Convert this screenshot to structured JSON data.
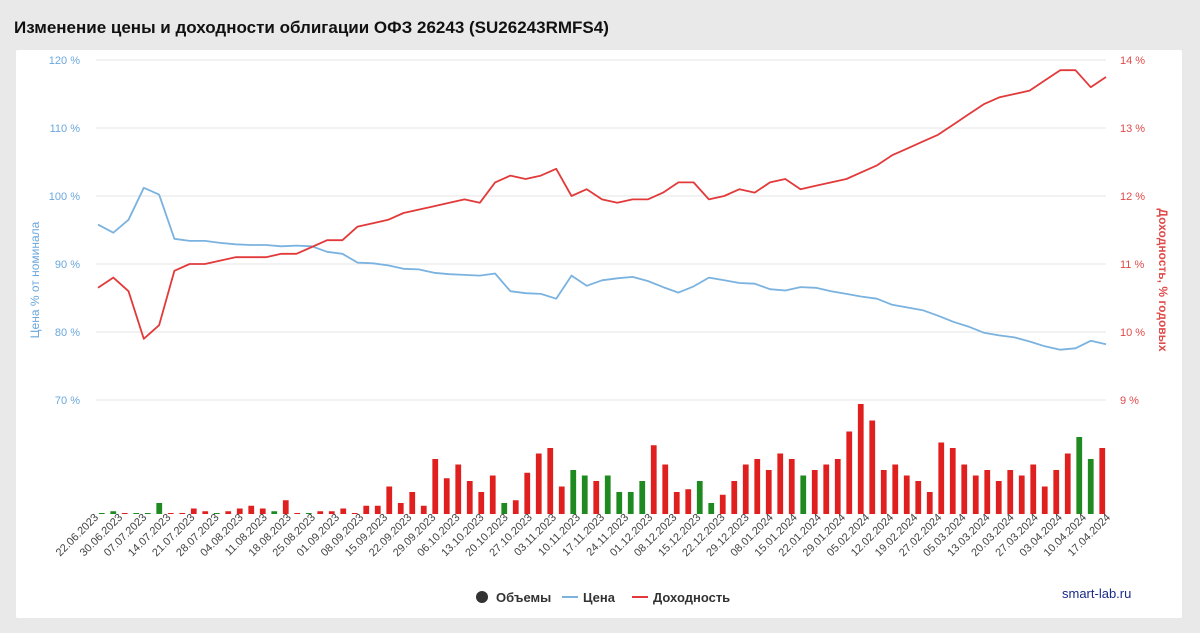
{
  "page": {
    "title": "Изменение цены и доходности облигации ОФЗ 26243 (SU26243RMFS4)",
    "credit": "smart-lab.ru"
  },
  "colors": {
    "price": "#7ab2e0",
    "yield": "#e23a3a",
    "volume_up": "#1f8a1f",
    "volume_down": "#e01f1f",
    "grid": "#e6e6e6"
  },
  "chart_data": {
    "type": "line",
    "title": "Изменение цены и доходности облигации ОФЗ 26243 (SU26243RMFS4)",
    "y_left": {
      "label": "Цена % от номинала",
      "range": [
        70,
        120
      ],
      "ticks": [
        70,
        80,
        90,
        100,
        110,
        120
      ],
      "tick_labels": [
        "70 %",
        "80 %",
        "90 %",
        "100 %",
        "110 %",
        "120 %"
      ]
    },
    "y_right": {
      "label": "Доходность, % годовых",
      "range": [
        9,
        14
      ],
      "ticks": [
        9,
        10,
        11,
        12,
        13,
        14
      ],
      "tick_labels": [
        "9 %",
        "10 %",
        "11 %",
        "12 %",
        "13 %",
        "14 %"
      ]
    },
    "x": {
      "labels": [
        "22.06.2023",
        "30.06.2023",
        "07.07.2023",
        "14.07.2023",
        "21.07.2023",
        "28.07.2023",
        "04.08.2023",
        "11.08.2023",
        "18.08.2023",
        "25.08.2023",
        "01.09.2023",
        "08.09.2023",
        "15.09.2023",
        "22.09.2023",
        "29.09.2023",
        "06.10.2023",
        "13.10.2023",
        "20.10.2023",
        "27.10.2023",
        "03.11.2023",
        "10.11.2023",
        "17.11.2023",
        "24.11.2023",
        "01.12.2023",
        "08.12.2023",
        "15.12.2023",
        "22.12.2023",
        "29.12.2023",
        "08.01.2024",
        "15.01.2024",
        "22.01.2024",
        "29.01.2024",
        "05.02.2024",
        "12.02.2024",
        "19.02.2024",
        "27.02.2024",
        "05.03.2024",
        "13.03.2024",
        "20.03.2024",
        "27.03.2024",
        "03.04.2024",
        "10.04.2024",
        "17.04.2024"
      ]
    },
    "series": [
      {
        "name": "Цена",
        "axis": "left",
        "values": [
          95.8,
          94.6,
          96.5,
          101.2,
          100.2,
          93.7,
          93.4,
          93.4,
          93.1,
          92.9,
          92.8,
          92.8,
          92.6,
          92.7,
          92.6,
          91.8,
          91.5,
          90.2,
          90.1,
          89.8,
          89.3,
          89.2,
          88.7,
          88.5,
          88.4,
          88.3,
          88.6,
          86.0,
          85.7,
          85.6,
          84.9,
          88.3,
          86.8,
          87.6,
          87.9,
          88.1,
          87.5,
          86.6,
          85.8,
          86.7,
          88.0,
          87.6,
          87.2,
          87.1,
          86.3,
          86.1,
          86.6,
          86.5,
          86.0,
          85.6,
          85.2,
          84.9,
          84.0,
          83.6,
          83.2,
          82.4,
          81.5,
          80.8,
          79.9,
          79.5,
          79.2,
          78.6,
          77.9,
          77.4,
          77.6,
          78.7,
          78.2
        ]
      },
      {
        "name": "Доходность",
        "axis": "right",
        "values": [
          10.65,
          10.8,
          10.6,
          9.9,
          10.1,
          10.9,
          11.0,
          11.0,
          11.05,
          11.1,
          11.1,
          11.1,
          11.15,
          11.15,
          11.25,
          11.35,
          11.35,
          11.55,
          11.6,
          11.65,
          11.75,
          11.8,
          11.85,
          11.9,
          11.95,
          11.9,
          12.2,
          12.3,
          12.25,
          12.3,
          12.4,
          12.0,
          12.1,
          11.95,
          11.9,
          11.95,
          11.95,
          12.05,
          12.2,
          12.2,
          11.95,
          12.0,
          12.1,
          12.05,
          12.2,
          12.25,
          12.1,
          12.15,
          12.2,
          12.25,
          12.35,
          12.45,
          12.6,
          12.7,
          12.8,
          12.9,
          13.05,
          13.2,
          13.35,
          13.45,
          13.5,
          13.55,
          13.7,
          13.85,
          13.85,
          13.6,
          13.75
        ]
      }
    ],
    "volumes": [
      0,
      1,
      0,
      0,
      0,
      4,
      0,
      0,
      2,
      1,
      0,
      1,
      2,
      3,
      2,
      1,
      5,
      0,
      0,
      1,
      1,
      2,
      0,
      3,
      3,
      10,
      4,
      8,
      3,
      20,
      13,
      18,
      12,
      8,
      14,
      4,
      5,
      15,
      22,
      24,
      10,
      16,
      14,
      12,
      14,
      8,
      8,
      12,
      25,
      18,
      8,
      9,
      12,
      4,
      7,
      12,
      18,
      20,
      16,
      22,
      20,
      14,
      16,
      18,
      20,
      30,
      40,
      34,
      16,
      18,
      14,
      12,
      8,
      26,
      24,
      18,
      14,
      16,
      12,
      16,
      14,
      18,
      10,
      16,
      22,
      28,
      20,
      24
    ],
    "volumes_note": "",
    "legend": [
      {
        "label": "Объемы",
        "marker": "circle"
      },
      {
        "label": "Цена",
        "marker": "line"
      },
      {
        "label": "Доходность",
        "marker": "line"
      }
    ],
    "grid": "horizontal"
  }
}
